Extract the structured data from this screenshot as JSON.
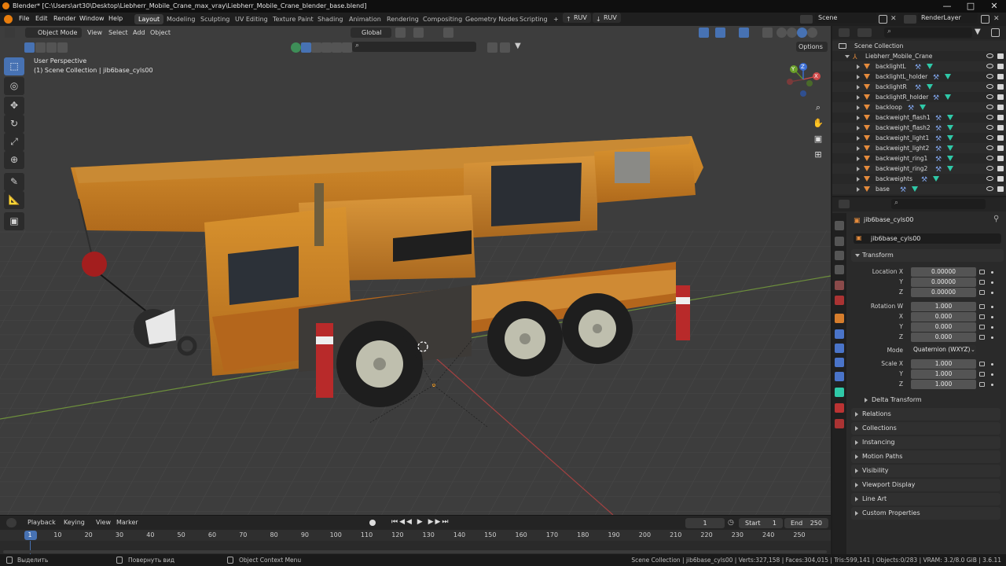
{
  "window": {
    "title": "Blender* [C:\\Users\\art30\\Desktop\\Liebherr_Mobile_Crane_max_vray\\Liebherr_Mobile_Crane_blender_base.blend]",
    "controls": [
      "—",
      "□",
      "✕"
    ]
  },
  "menu": {
    "items": [
      "File",
      "Edit",
      "Render",
      "Window",
      "Help"
    ],
    "workspaces": [
      "Layout",
      "Modeling",
      "Sculpting",
      "UV Editing",
      "Texture Paint",
      "Shading",
      "Animation",
      "Rendering",
      "Compositing",
      "Geometry Nodes",
      "Scripting"
    ],
    "active_workspace": "Layout",
    "add_tab": "+",
    "ruv_buttons": [
      "RUV",
      "RUV"
    ],
    "scene": "Scene",
    "view_layer": "RenderLayer"
  },
  "viewport": {
    "mode": "Object Mode",
    "menus": [
      "View",
      "Select",
      "Add",
      "Object"
    ],
    "transform_orientation": "Global",
    "options_label": "Options",
    "view_name": "User Perspective",
    "collection_info": "(1) Scene Collection | jib6base_cyls00",
    "gizmo_axes": [
      "X",
      "Y",
      "Z"
    ],
    "nav_icons": [
      "zoom-icon",
      "pan-hand-icon",
      "camera-icon",
      "grid-icon"
    ]
  },
  "timeline": {
    "menus": [
      "Playback",
      "Keying",
      "View",
      "Marker"
    ],
    "current_frame": "1",
    "start_label": "Start",
    "start_value": "1",
    "end_label": "End",
    "end_value": "250",
    "ticks": [
      "1",
      "10",
      "20",
      "30",
      "40",
      "50",
      "60",
      "70",
      "80",
      "90",
      "100",
      "110",
      "120",
      "130",
      "140",
      "150",
      "160",
      "170",
      "180",
      "190",
      "200",
      "210",
      "220",
      "230",
      "240",
      "250"
    ]
  },
  "statusbar": {
    "left": "Выделить",
    "middle": "Повернуть вид",
    "context": "Object Context Menu",
    "stats": "Scene Collection | jib6base_cyls00 | Verts:327,158 | Faces:304,015 | Tris:599,141 | Objects:0/283 | VRAM: 3.2/8.0 GiB | 3.6.11"
  },
  "outliner": {
    "scene_collection": "Scene Collection",
    "root": "Liebherr_Mobile_Crane",
    "items": [
      "backlightL",
      "backlightL_holder",
      "backlightR",
      "backlightR_holder",
      "backloop",
      "backweight_flash1",
      "backweight_flash2",
      "backweight_light1",
      "backweight_light2",
      "backweight_ring1",
      "backweight_ring2",
      "backweights",
      "base"
    ]
  },
  "properties": {
    "object_name": "jib6base_cyls00",
    "data_name": "jib6base_cyls00",
    "transform_label": "Transform",
    "location_label": "Location X",
    "location": [
      "0.00000",
      "0.00000",
      "0.00000"
    ],
    "rotation_label": "Rotation W",
    "rotation": [
      "1.000",
      "0.000",
      "0.000",
      "0.000"
    ],
    "mode_label": "Mode",
    "mode_value": "Quaternion (WXYZ)",
    "scale_label": "Scale X",
    "scale": [
      "1.000",
      "1.000",
      "1.000"
    ],
    "axis_labels": [
      "Y",
      "Z",
      "X",
      "Y",
      "Z",
      "Y",
      "Z"
    ],
    "delta_transform": "Delta Transform",
    "sections": [
      "Relations",
      "Collections",
      "Instancing",
      "Motion Paths",
      "Visibility",
      "Viewport Display",
      "Line Art",
      "Custom Properties"
    ]
  }
}
